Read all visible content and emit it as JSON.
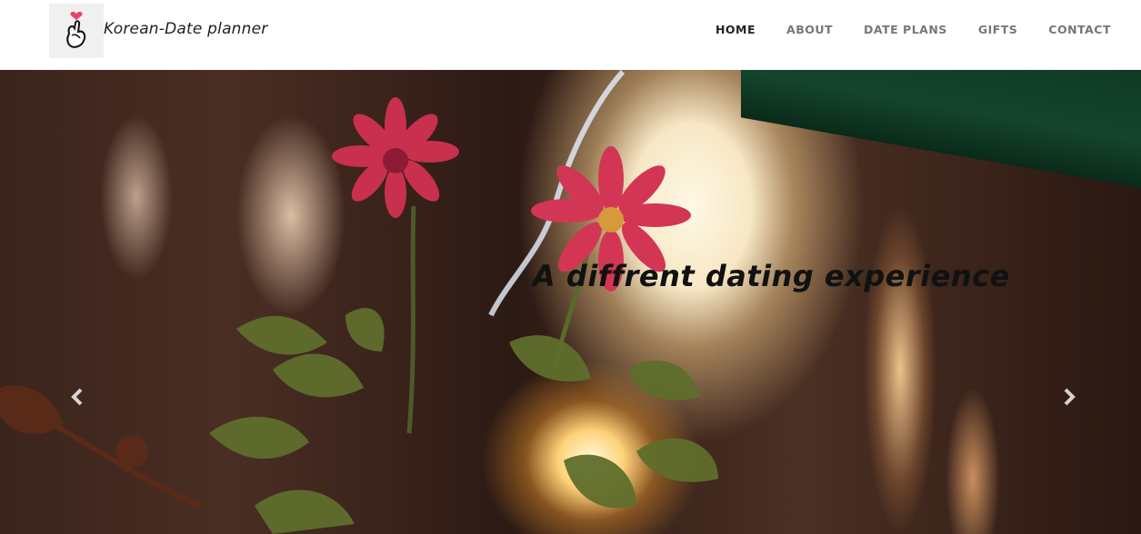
{
  "brand": {
    "name": "Korean-Date planner",
    "logo_icon": "finger-heart-icon"
  },
  "nav": {
    "items": [
      {
        "label": "HOME",
        "active": true
      },
      {
        "label": "ABOUT",
        "active": false
      },
      {
        "label": "DATE PLANS",
        "active": false
      },
      {
        "label": "GIFTS",
        "active": false
      },
      {
        "label": "CONTACT",
        "active": false
      }
    ]
  },
  "hero": {
    "headline": "A diffrent dating experience",
    "prev_icon": "chevron-left-icon",
    "next_icon": "chevron-right-icon"
  }
}
